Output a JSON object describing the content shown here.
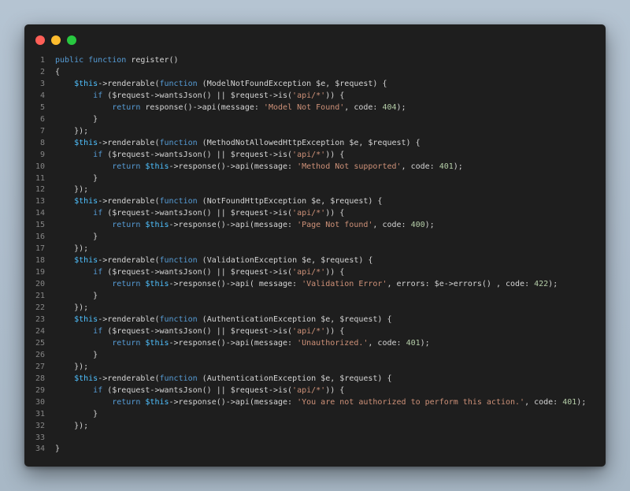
{
  "window": {
    "controls": [
      "close",
      "minimize",
      "maximize"
    ]
  },
  "colors": {
    "keyword": "#569cd6",
    "variable": "#4fc1ff",
    "string": "#ce9178",
    "number": "#b5cea8",
    "default": "#d4d4d4",
    "line_number": "#858585",
    "background": "#1e1e1e"
  },
  "code": {
    "language": "php",
    "lines": [
      {
        "n": "1",
        "tokens": [
          [
            "kw",
            "public function"
          ],
          [
            "def",
            " register()"
          ]
        ]
      },
      {
        "n": "2",
        "tokens": [
          [
            "def",
            "{"
          ]
        ]
      },
      {
        "n": "3",
        "tokens": [
          [
            "def",
            "    "
          ],
          [
            "var",
            "$this"
          ],
          [
            "def",
            "->renderable("
          ],
          [
            "kw",
            "function"
          ],
          [
            "def",
            " (ModelNotFoundException $e, $request) {"
          ]
        ]
      },
      {
        "n": "4",
        "tokens": [
          [
            "def",
            "        "
          ],
          [
            "kw",
            "if"
          ],
          [
            "def",
            " ($request->wantsJson() || $request->is("
          ],
          [
            "str",
            "'api/*'"
          ],
          [
            "def",
            ")) {"
          ]
        ]
      },
      {
        "n": "5",
        "tokens": [
          [
            "def",
            "            "
          ],
          [
            "kw",
            "return"
          ],
          [
            "def",
            " response()->api(message: "
          ],
          [
            "str",
            "'Model Not Found'"
          ],
          [
            "def",
            ", code: "
          ],
          [
            "num",
            "404"
          ],
          [
            "def",
            ");"
          ]
        ]
      },
      {
        "n": "6",
        "tokens": [
          [
            "def",
            "        }"
          ]
        ]
      },
      {
        "n": "7",
        "tokens": [
          [
            "def",
            "    });"
          ]
        ]
      },
      {
        "n": "8",
        "tokens": [
          [
            "def",
            "    "
          ],
          [
            "var",
            "$this"
          ],
          [
            "def",
            "->renderable("
          ],
          [
            "kw",
            "function"
          ],
          [
            "def",
            " (MethodNotAllowedHttpException $e, $request) {"
          ]
        ]
      },
      {
        "n": "9",
        "tokens": [
          [
            "def",
            "        "
          ],
          [
            "kw",
            "if"
          ],
          [
            "def",
            " ($request->wantsJson() || $request->is("
          ],
          [
            "str",
            "'api/*'"
          ],
          [
            "def",
            ")) {"
          ]
        ]
      },
      {
        "n": "10",
        "tokens": [
          [
            "def",
            "            "
          ],
          [
            "kw",
            "return"
          ],
          [
            "def",
            " "
          ],
          [
            "var",
            "$this"
          ],
          [
            "def",
            "->response()->api(message: "
          ],
          [
            "str",
            "'Method Not supported'"
          ],
          [
            "def",
            ", code: "
          ],
          [
            "num",
            "401"
          ],
          [
            "def",
            ");"
          ]
        ]
      },
      {
        "n": "11",
        "tokens": [
          [
            "def",
            "        }"
          ]
        ]
      },
      {
        "n": "12",
        "tokens": [
          [
            "def",
            "    });"
          ]
        ]
      },
      {
        "n": "13",
        "tokens": [
          [
            "def",
            "    "
          ],
          [
            "var",
            "$this"
          ],
          [
            "def",
            "->renderable("
          ],
          [
            "kw",
            "function"
          ],
          [
            "def",
            " (NotFoundHttpException $e, $request) {"
          ]
        ]
      },
      {
        "n": "14",
        "tokens": [
          [
            "def",
            "        "
          ],
          [
            "kw",
            "if"
          ],
          [
            "def",
            " ($request->wantsJson() || $request->is("
          ],
          [
            "str",
            "'api/*'"
          ],
          [
            "def",
            ")) {"
          ]
        ]
      },
      {
        "n": "15",
        "tokens": [
          [
            "def",
            "            "
          ],
          [
            "kw",
            "return"
          ],
          [
            "def",
            " "
          ],
          [
            "var",
            "$this"
          ],
          [
            "def",
            "->response()->api(message: "
          ],
          [
            "str",
            "'Page Not found'"
          ],
          [
            "def",
            ", code: "
          ],
          [
            "num",
            "400"
          ],
          [
            "def",
            ");"
          ]
        ]
      },
      {
        "n": "16",
        "tokens": [
          [
            "def",
            "        }"
          ]
        ]
      },
      {
        "n": "17",
        "tokens": [
          [
            "def",
            "    });"
          ]
        ]
      },
      {
        "n": "18",
        "tokens": [
          [
            "def",
            "    "
          ],
          [
            "var",
            "$this"
          ],
          [
            "def",
            "->renderable("
          ],
          [
            "kw",
            "function"
          ],
          [
            "def",
            " (ValidationException $e, $request) {"
          ]
        ]
      },
      {
        "n": "19",
        "tokens": [
          [
            "def",
            "        "
          ],
          [
            "kw",
            "if"
          ],
          [
            "def",
            " ($request->wantsJson() || $request->is("
          ],
          [
            "str",
            "'api/*'"
          ],
          [
            "def",
            ")) {"
          ]
        ]
      },
      {
        "n": "20",
        "tokens": [
          [
            "def",
            "            "
          ],
          [
            "kw",
            "return"
          ],
          [
            "def",
            " "
          ],
          [
            "var",
            "$this"
          ],
          [
            "def",
            "->response()->api( message: "
          ],
          [
            "str",
            "'Validation Error'"
          ],
          [
            "def",
            ", errors: $e->errors() , code: "
          ],
          [
            "num",
            "422"
          ],
          [
            "def",
            ");"
          ]
        ]
      },
      {
        "n": "21",
        "tokens": [
          [
            "def",
            "        }"
          ]
        ]
      },
      {
        "n": "22",
        "tokens": [
          [
            "def",
            "    });"
          ]
        ]
      },
      {
        "n": "23",
        "tokens": [
          [
            "def",
            "    "
          ],
          [
            "var",
            "$this"
          ],
          [
            "def",
            "->renderable("
          ],
          [
            "kw",
            "function"
          ],
          [
            "def",
            " (AuthenticationException $e, $request) {"
          ]
        ]
      },
      {
        "n": "24",
        "tokens": [
          [
            "def",
            "        "
          ],
          [
            "kw",
            "if"
          ],
          [
            "def",
            " ($request->wantsJson() || $request->is("
          ],
          [
            "str",
            "'api/*'"
          ],
          [
            "def",
            ")) {"
          ]
        ]
      },
      {
        "n": "25",
        "tokens": [
          [
            "def",
            "            "
          ],
          [
            "kw",
            "return"
          ],
          [
            "def",
            " "
          ],
          [
            "var",
            "$this"
          ],
          [
            "def",
            "->response()->api(message: "
          ],
          [
            "str",
            "'Unauthorized.'"
          ],
          [
            "def",
            ", code: "
          ],
          [
            "num",
            "401"
          ],
          [
            "def",
            ");"
          ]
        ]
      },
      {
        "n": "26",
        "tokens": [
          [
            "def",
            "        }"
          ]
        ]
      },
      {
        "n": "27",
        "tokens": [
          [
            "def",
            "    });"
          ]
        ]
      },
      {
        "n": "28",
        "tokens": [
          [
            "def",
            "    "
          ],
          [
            "var",
            "$this"
          ],
          [
            "def",
            "->renderable("
          ],
          [
            "kw",
            "function"
          ],
          [
            "def",
            " (AuthenticationException $e, $request) {"
          ]
        ]
      },
      {
        "n": "29",
        "tokens": [
          [
            "def",
            "        "
          ],
          [
            "kw",
            "if"
          ],
          [
            "def",
            " ($request->wantsJson() || $request->is("
          ],
          [
            "str",
            "'api/*'"
          ],
          [
            "def",
            ")) {"
          ]
        ]
      },
      {
        "n": "30",
        "tokens": [
          [
            "def",
            "            "
          ],
          [
            "kw",
            "return"
          ],
          [
            "def",
            " "
          ],
          [
            "var",
            "$this"
          ],
          [
            "def",
            "->response()->api(message: "
          ],
          [
            "str",
            "'You are not authorized to perform this action.'"
          ],
          [
            "def",
            ", code: "
          ],
          [
            "num",
            "401"
          ],
          [
            "def",
            ");"
          ]
        ]
      },
      {
        "n": "31",
        "tokens": [
          [
            "def",
            "        }"
          ]
        ]
      },
      {
        "n": "32",
        "tokens": [
          [
            "def",
            "    });"
          ]
        ]
      },
      {
        "n": "33",
        "tokens": [
          [
            "def",
            ""
          ]
        ]
      },
      {
        "n": "34",
        "tokens": [
          [
            "def",
            "}"
          ]
        ]
      }
    ]
  }
}
